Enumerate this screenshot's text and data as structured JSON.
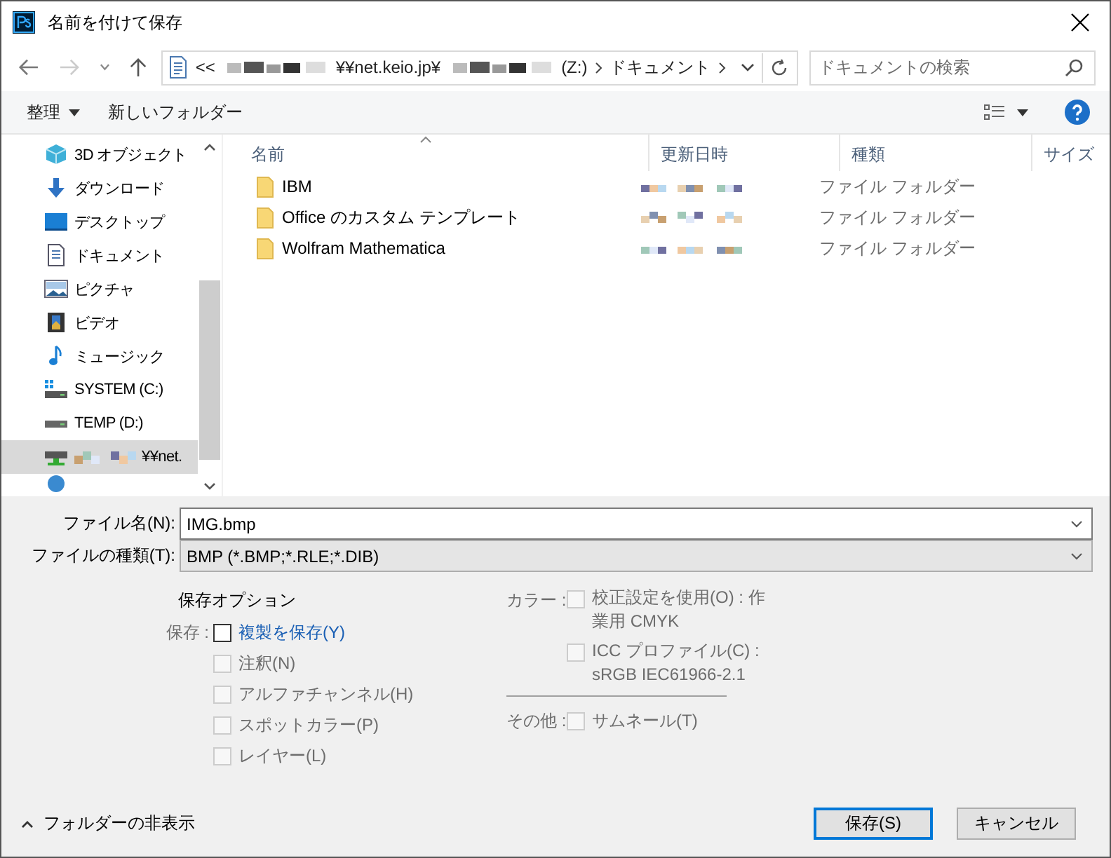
{
  "window": {
    "title": "名前を付けて保存"
  },
  "address": {
    "prefix": "<<",
    "segments": [
      {
        "text": "¥¥net.keio.jp¥",
        "kind": "obscured_before"
      },
      {
        "text": "(Z:)",
        "kind": "obscured_before"
      },
      {
        "text": "ドキュメント",
        "kind": "plain"
      }
    ]
  },
  "search": {
    "placeholder": "ドキュメントの検索"
  },
  "toolbar": {
    "organize": "整理",
    "new_folder": "新しいフォルダー"
  },
  "sidebar": {
    "items": [
      {
        "label": "3D オブジェクト",
        "kind": "cube",
        "selected": false
      },
      {
        "label": "ダウンロード",
        "kind": "download",
        "selected": false
      },
      {
        "label": "デスクトップ",
        "kind": "desktop",
        "selected": false
      },
      {
        "label": "ドキュメント",
        "kind": "document",
        "selected": false
      },
      {
        "label": "ピクチャ",
        "kind": "pictures",
        "selected": false
      },
      {
        "label": "ビデオ",
        "kind": "video",
        "selected": false
      },
      {
        "label": "ミュージック",
        "kind": "music",
        "selected": false
      },
      {
        "label": "SYSTEM (C:)",
        "kind": "system",
        "selected": false
      },
      {
        "label": "TEMP (D:)",
        "kind": "drive",
        "selected": false
      },
      {
        "label": "¥¥net.",
        "kind": "network_drive",
        "selected": true
      }
    ]
  },
  "table": {
    "columns": [
      "名前",
      "更新日時",
      "種類",
      "サイズ"
    ],
    "rows": [
      {
        "name": "IBM",
        "type": "ファイル フォルダー"
      },
      {
        "name": "Office のカスタム テンプレート",
        "type": "ファイル フォルダー"
      },
      {
        "name": "Wolfram Mathematica",
        "type": "ファイル フォルダー"
      }
    ]
  },
  "file_name": {
    "label": "ファイル名(N):",
    "value": "IMG.bmp"
  },
  "file_type": {
    "label": "ファイルの種類(T):",
    "value": "BMP (*.BMP;*.RLE;*.DIB)"
  },
  "options": {
    "title": "保存オプション",
    "left": [
      {
        "group": "保存 :",
        "label": "複製を保存(Y)",
        "checked": false,
        "disabled": false
      },
      {
        "label": "注釈(N)",
        "checked": false,
        "disabled": true
      },
      {
        "label": "アルファチャンネル(H)",
        "checked": false,
        "disabled": true
      },
      {
        "label": "スポットカラー(P)",
        "checked": false,
        "disabled": true
      },
      {
        "label": "レイヤー(L)",
        "checked": false,
        "disabled": true
      }
    ],
    "color": [
      {
        "group": "カラー :",
        "label": "校正設定を使用(O) : 作",
        "detail": "業用 CMYK",
        "checked": false,
        "disabled": true
      },
      {
        "label": "ICC プロファイル(C) :",
        "detail": "sRGB IEC61966-2.1",
        "checked": false,
        "disabled": true
      }
    ],
    "other": [
      {
        "group": "その他 :",
        "label": "サムネール(T)",
        "checked": false,
        "disabled": true
      }
    ]
  },
  "hide_folders": "フォルダーの非表示",
  "buttons": [
    {
      "label": "保存(S)",
      "kind": "primary"
    },
    {
      "label": "キャンセル",
      "kind": "normal"
    }
  ]
}
